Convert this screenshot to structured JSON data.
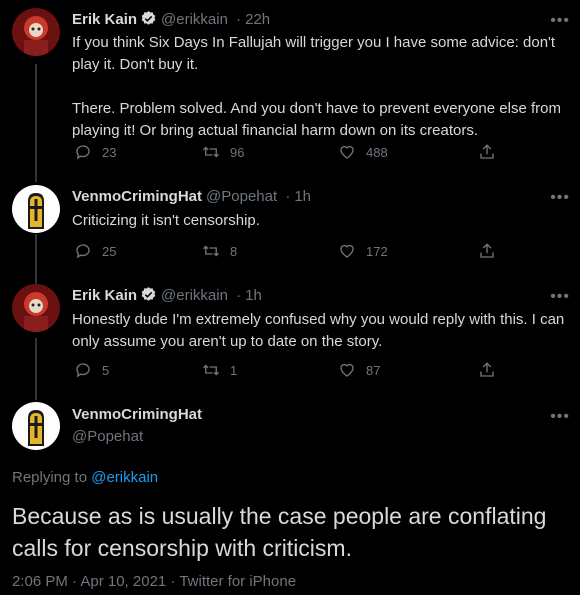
{
  "tweets": [
    {
      "name": "Erik Kain",
      "handle": "@erikkain",
      "time": "22h",
      "text": "If you think Six Days In Fallujah will trigger you I have some advice: don't play it. Don't buy it.\n\nThere. Problem solved. And you don't have to prevent everyone else from playing it! Or bring actual financial harm down on its creators.",
      "replies": "23",
      "retweets": "96",
      "likes": "488"
    },
    {
      "name": "VenmoCrimingHat",
      "handle": "@Popehat",
      "time": "1h",
      "text": "Criticizing it isn't censorship.",
      "replies": "25",
      "retweets": "8",
      "likes": "172"
    },
    {
      "name": "Erik Kain",
      "handle": "@erikkain",
      "time": "1h",
      "text": "Honestly dude I'm extremely confused why you would reply with this. I can only assume you aren't up to date on the story.",
      "replies": "5",
      "retweets": "1",
      "likes": "87"
    }
  ],
  "main": {
    "name": "VenmoCrimingHat",
    "handle": "@Popehat",
    "replying_prefix": "Replying to",
    "replying_to": "@erikkain",
    "text": "Because as is usually the case people are conflating calls for censorship with criticism.",
    "meta": "2:06 PM · Apr 10, 2021 · Twitter for iPhone"
  },
  "sep": "·",
  "more_label": "•••",
  "colors": {
    "background": "#000000",
    "accent": "#1d9bf0",
    "muted": "#6e767d",
    "text": "#d9d9d9"
  },
  "icons": [
    "reply-icon",
    "retweet-icon",
    "like-icon",
    "share-icon",
    "verified-icon",
    "more-icon"
  ]
}
